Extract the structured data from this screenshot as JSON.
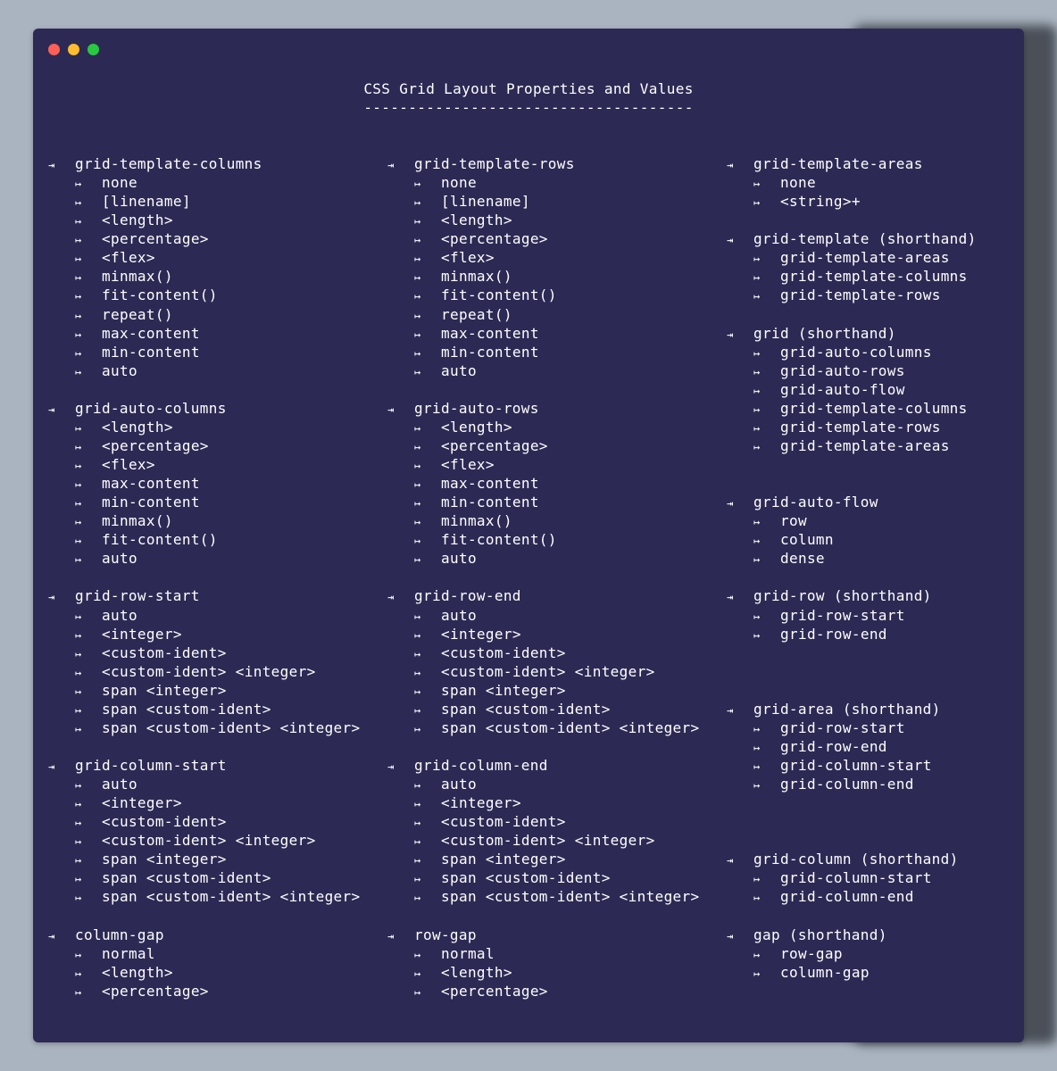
{
  "window": {
    "controls": {
      "close": "#ff5f57",
      "minimize": "#febc2e",
      "zoom": "#28c840"
    }
  },
  "title": "CSS Grid Layout Properties and Values",
  "title_underline": "-------------------------------------",
  "icons": {
    "property": "⇥",
    "value": "↦"
  },
  "columns": [
    {
      "groups": [
        {
          "pre": 0,
          "name": "grid-template-columns",
          "values": [
            "none",
            "[linename]",
            "<length>",
            "<percentage>",
            "<flex>",
            "minmax()",
            "fit-content()",
            "repeat()",
            "max-content",
            "min-content",
            "auto"
          ]
        },
        {
          "pre": 1,
          "name": "grid-auto-columns",
          "values": [
            "<length>",
            "<percentage>",
            "<flex>",
            "max-content",
            "min-content",
            "minmax()",
            "fit-content()",
            "auto"
          ]
        },
        {
          "pre": 1,
          "name": "grid-row-start",
          "values": [
            "auto",
            "<integer>",
            "<custom-ident>",
            "<custom-ident> <integer>",
            "span <integer>",
            "span <custom-ident>",
            "span <custom-ident> <integer>"
          ]
        },
        {
          "pre": 1,
          "name": "grid-column-start",
          "values": [
            "auto",
            "<integer>",
            "<custom-ident>",
            "<custom-ident> <integer>",
            "span <integer>",
            "span <custom-ident>",
            "span <custom-ident> <integer>"
          ]
        },
        {
          "pre": 1,
          "name": "column-gap",
          "values": [
            "normal",
            "<length>",
            "<percentage>"
          ]
        }
      ]
    },
    {
      "groups": [
        {
          "pre": 0,
          "name": "grid-template-rows",
          "values": [
            "none",
            "[linename]",
            "<length>",
            "<percentage>",
            "<flex>",
            "minmax()",
            "fit-content()",
            "repeat()",
            "max-content",
            "min-content",
            "auto"
          ]
        },
        {
          "pre": 1,
          "name": "grid-auto-rows",
          "values": [
            "<length>",
            "<percentage>",
            "<flex>",
            "max-content",
            "min-content",
            "minmax()",
            "fit-content()",
            "auto"
          ]
        },
        {
          "pre": 1,
          "name": "grid-row-end",
          "values": [
            "auto",
            "<integer>",
            "<custom-ident>",
            "<custom-ident> <integer>",
            "span <integer>",
            "span <custom-ident>",
            "span <custom-ident> <integer>"
          ]
        },
        {
          "pre": 1,
          "name": "grid-column-end",
          "values": [
            "auto",
            "<integer>",
            "<custom-ident>",
            "<custom-ident> <integer>",
            "span <integer>",
            "span <custom-ident>",
            "span <custom-ident> <integer>"
          ]
        },
        {
          "pre": 1,
          "name": "row-gap",
          "values": [
            "normal",
            "<length>",
            "<percentage>"
          ]
        }
      ]
    },
    {
      "groups": [
        {
          "pre": 0,
          "name": "grid-template-areas",
          "values": [
            "none",
            "<string>+"
          ]
        },
        {
          "pre": 1,
          "name": "grid-template (shorthand)",
          "values": [
            "grid-template-areas",
            "grid-template-columns",
            "grid-template-rows"
          ]
        },
        {
          "pre": 1,
          "name": "grid (shorthand)",
          "values": [
            "grid-auto-columns",
            "grid-auto-rows",
            "grid-auto-flow",
            "grid-template-columns",
            "grid-template-rows",
            "grid-template-areas"
          ]
        },
        {
          "pre": 2,
          "name": "grid-auto-flow",
          "values": [
            "row",
            "column",
            "dense"
          ]
        },
        {
          "pre": 1,
          "name": "grid-row (shorthand)",
          "values": [
            "grid-row-start",
            "grid-row-end"
          ]
        },
        {
          "pre": 3,
          "name": "grid-area (shorthand)",
          "values": [
            "grid-row-start",
            "grid-row-end",
            "grid-column-start",
            "grid-column-end"
          ]
        },
        {
          "pre": 3,
          "name": "grid-column (shorthand)",
          "values": [
            "grid-column-start",
            "grid-column-end"
          ]
        },
        {
          "pre": 1,
          "name": "gap (shorthand)",
          "values": [
            "row-gap",
            "column-gap"
          ]
        }
      ]
    }
  ]
}
